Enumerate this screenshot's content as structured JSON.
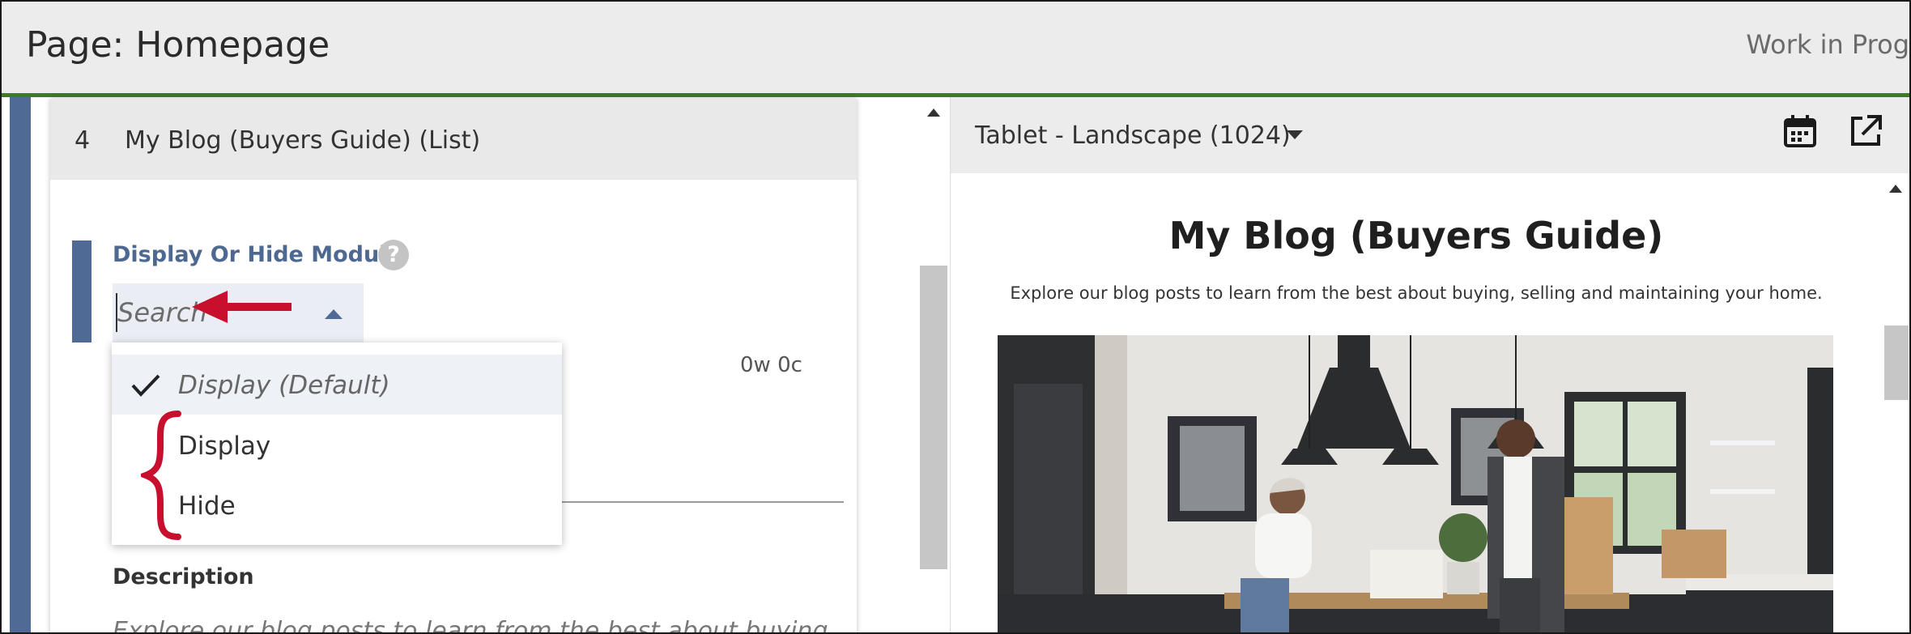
{
  "header": {
    "page_title": "Page: Homepage",
    "status": "Work in Prog"
  },
  "module": {
    "number": "4",
    "name": "My Blog (Buyers Guide) (List)"
  },
  "field": {
    "label": "Display Or Hide Module",
    "help_symbol": "?",
    "search_placeholder": "Search",
    "counter": "0w 0c"
  },
  "dropdown": {
    "selected_label": "Display (Default)",
    "options": [
      {
        "label": "Display (Default)",
        "selected": true
      },
      {
        "label": "Display",
        "selected": false
      },
      {
        "label": "Hide",
        "selected": false
      }
    ]
  },
  "description": {
    "label": "Description",
    "text": "Explore our blog posts to learn from the best about buying"
  },
  "preview": {
    "device": "Tablet - Landscape (1024)",
    "title": "My Blog (Buyers Guide)",
    "subtitle": "Explore our blog posts to learn from the best about buying, selling and maintaining your home."
  },
  "icons": {
    "help": "question-circle-icon",
    "dropdown_toggle": "caret-up-icon",
    "selected": "check-icon",
    "device_toggle": "caret-down-icon",
    "schedule": "calendar-icon",
    "open_external": "external-link-icon",
    "annotation_arrow": "red-arrow-annotation",
    "annotation_brace": "red-brace-annotation"
  },
  "colors": {
    "accent": "#4e6a95",
    "header_border": "#3f7d1c",
    "annotation": "#c8102e"
  }
}
